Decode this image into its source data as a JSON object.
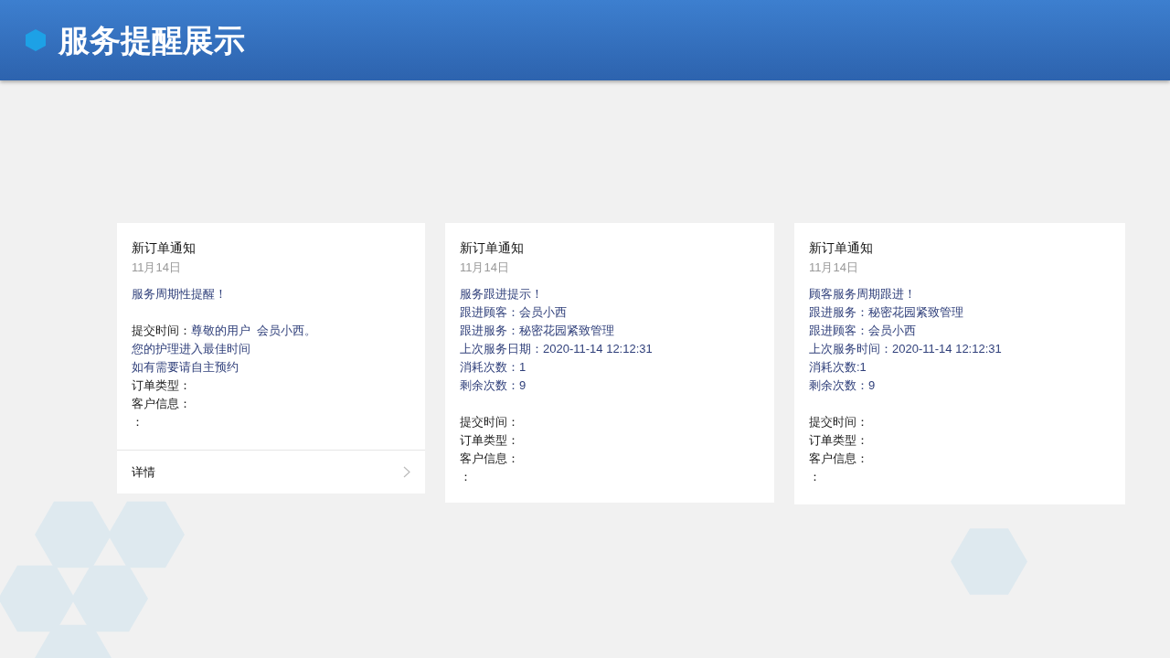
{
  "header": {
    "title": "服务提醒展示"
  },
  "cards": [
    {
      "title": "新订单通知",
      "date": "11月14日",
      "sections": [
        [
          {
            "kind": "accent",
            "text": "服务周期性提醒！"
          }
        ],
        [
          {
            "kind": "field",
            "label": "提交时间：",
            "value": "尊敬的用户  会员小西。"
          },
          {
            "kind": "accent",
            "text": "您的护理进入最佳时间"
          },
          {
            "kind": "accent",
            "text": "如有需要请自主预约"
          },
          {
            "kind": "field",
            "label": "订单类型："
          },
          {
            "kind": "field",
            "label": "客户信息："
          },
          {
            "kind": "field",
            "label": "："
          }
        ]
      ],
      "footer": {
        "label": "详情"
      }
    },
    {
      "title": "新订单通知",
      "date": "11月14日",
      "sections": [
        [
          {
            "kind": "accent",
            "text": "服务跟进提示！"
          },
          {
            "kind": "accent",
            "text": "跟进顾客：会员小西"
          },
          {
            "kind": "accent",
            "text": "跟进服务：秘密花园紧致管理"
          },
          {
            "kind": "accent",
            "text": "上次服务日期：2020-11-14 12:12:31"
          },
          {
            "kind": "accent",
            "text": "消耗次数：1"
          },
          {
            "kind": "accent",
            "text": "剩余次数：9"
          }
        ],
        [
          {
            "kind": "field",
            "label": "提交时间："
          },
          {
            "kind": "field",
            "label": "订单类型："
          },
          {
            "kind": "field",
            "label": "客户信息："
          },
          {
            "kind": "field",
            "label": "："
          }
        ]
      ]
    },
    {
      "title": "新订单通知",
      "date": "11月14日",
      "sections": [
        [
          {
            "kind": "accent",
            "text": "顾客服务周期跟进！"
          },
          {
            "kind": "accent",
            "text": "跟进服务：秘密花园紧致管理"
          },
          {
            "kind": "accent",
            "text": "跟进顾客：会员小西"
          },
          {
            "kind": "accent",
            "text": "上次服务时间：2020-11-14 12:12:31"
          },
          {
            "kind": "accent",
            "text": "消耗次数:1"
          },
          {
            "kind": "accent",
            "text": "剩余次数：9"
          }
        ],
        [
          {
            "kind": "field",
            "label": "提交时间："
          },
          {
            "kind": "field",
            "label": "订单类型："
          },
          {
            "kind": "field",
            "label": "客户信息："
          },
          {
            "kind": "field",
            "label": "："
          }
        ]
      ]
    }
  ]
}
